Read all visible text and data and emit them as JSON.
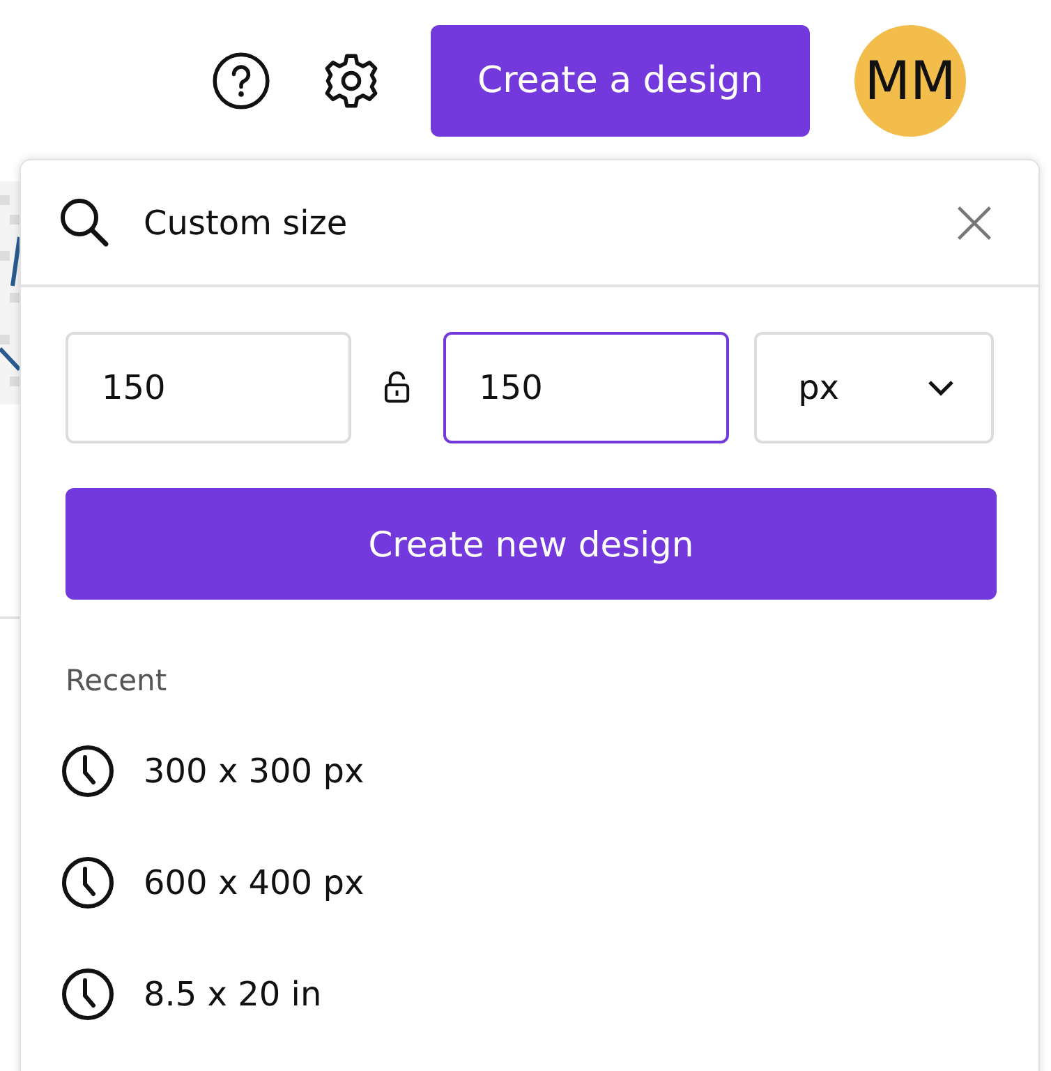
{
  "header": {
    "create_button": "Create a design",
    "avatar": "MM"
  },
  "panel": {
    "search": {
      "value": "Custom size"
    },
    "fields": [
      {
        "kind": "number",
        "value": "150",
        "focused": false
      },
      {
        "kind": "number",
        "value": "150",
        "focused": true
      },
      {
        "kind": "unit",
        "value": "px",
        "focused": false
      }
    ],
    "create_button": "Create new design",
    "recent_label": "Recent",
    "recent": [
      "300 x 300 px",
      "600 x 400 px",
      "8.5 x 20 in"
    ]
  }
}
